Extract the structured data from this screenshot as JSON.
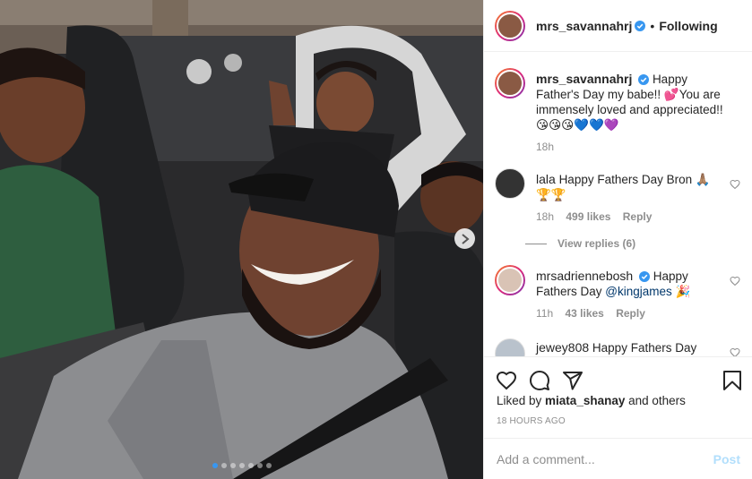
{
  "post": {
    "author": "mrs_savannahrj",
    "follow_separator": "•",
    "follow_label": "Following",
    "photo_dots": 7,
    "active_dot": 0
  },
  "comments": [
    {
      "user": "mrs_savannahrj",
      "text": "Happy Father's Day my babe!! 💕You are immensely loved and appreciated!! 😘😘😘💙💙💜",
      "time": "18h"
    },
    {
      "user": "lala",
      "text": "Happy Fathers Day Bron 🙏🏽🏆🏆",
      "time": "18h",
      "likes": "499 likes",
      "reply": "Reply",
      "view_replies": "View replies (6)"
    },
    {
      "user": "mrsadriennebosh",
      "text_before": "Happy Fathers Day ",
      "mention": "@kingjames",
      "text_after": " 🎉",
      "time": "11h",
      "likes": "43 likes",
      "reply": "Reply"
    },
    {
      "user": "jewey808",
      "text": "Happy Fathers Day"
    }
  ],
  "actions": {
    "liked_by_prefix": "Liked by ",
    "liked_by_user": "miata_shanay",
    "liked_by_suffix": " and others",
    "timestamp": "18 HOURS AGO"
  },
  "composer": {
    "placeholder": "Add a comment...",
    "post_label": "Post"
  },
  "colors": {
    "verified": "#3897f0",
    "post_disabled": "#b2dffc",
    "mention": "#00376b"
  }
}
